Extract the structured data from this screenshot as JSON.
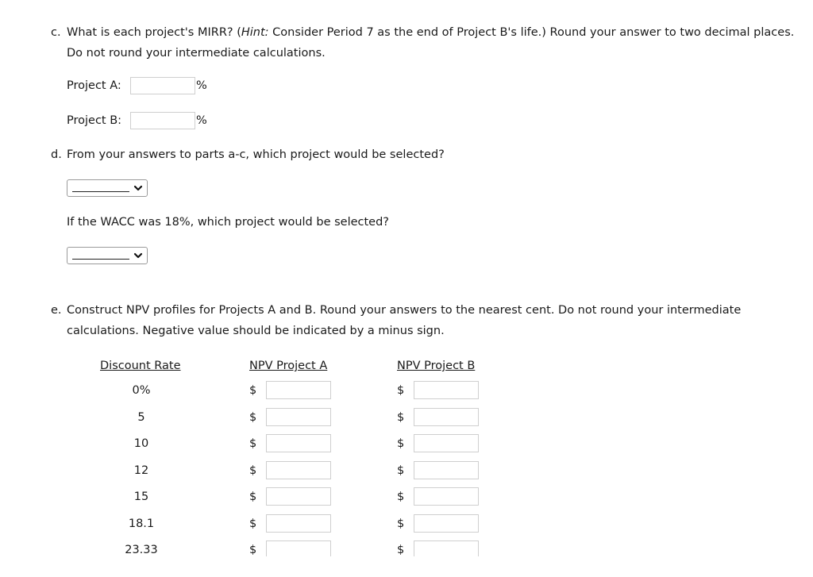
{
  "part_c": {
    "label": "c.",
    "text_before_hint": "What is each project's MIRR? (",
    "hint_label": "Hint:",
    "text_after_hint": " Consider Period 7 as the end of Project B's life.) Round your answer to two decimal places. Do not round your intermediate calculations.",
    "fields": [
      {
        "label": "Project A:",
        "value": "",
        "unit": "%"
      },
      {
        "label": "Project B:",
        "value": "",
        "unit": "%"
      }
    ]
  },
  "part_d": {
    "label": "d.",
    "question": "From your answers to parts a-c, which project would be selected?",
    "select_1": {
      "selected": "",
      "icon": "chevron-down-icon"
    },
    "followup_question": "If the WACC was 18%, which project would be selected?",
    "select_2": {
      "selected": "",
      "icon": "chevron-down-icon"
    }
  },
  "part_e": {
    "label": "e.",
    "question": "Construct NPV profiles for Projects A and B. Round your answers to the nearest cent. Do not round your intermediate calculations. Negative value should be indicated by a minus sign.",
    "table": {
      "headers": [
        "Discount Rate",
        "NPV Project A",
        "NPV Project B"
      ],
      "currency_symbol": "$",
      "rows": [
        {
          "rate": "0%",
          "npv_a": "",
          "npv_b": ""
        },
        {
          "rate": "5",
          "npv_a": "",
          "npv_b": ""
        },
        {
          "rate": "10",
          "npv_a": "",
          "npv_b": ""
        },
        {
          "rate": "12",
          "npv_a": "",
          "npv_b": ""
        },
        {
          "rate": "15",
          "npv_a": "",
          "npv_b": ""
        },
        {
          "rate": "18.1",
          "npv_a": "",
          "npv_b": ""
        },
        {
          "rate": "23.33",
          "npv_a": "",
          "npv_b": ""
        }
      ]
    }
  }
}
